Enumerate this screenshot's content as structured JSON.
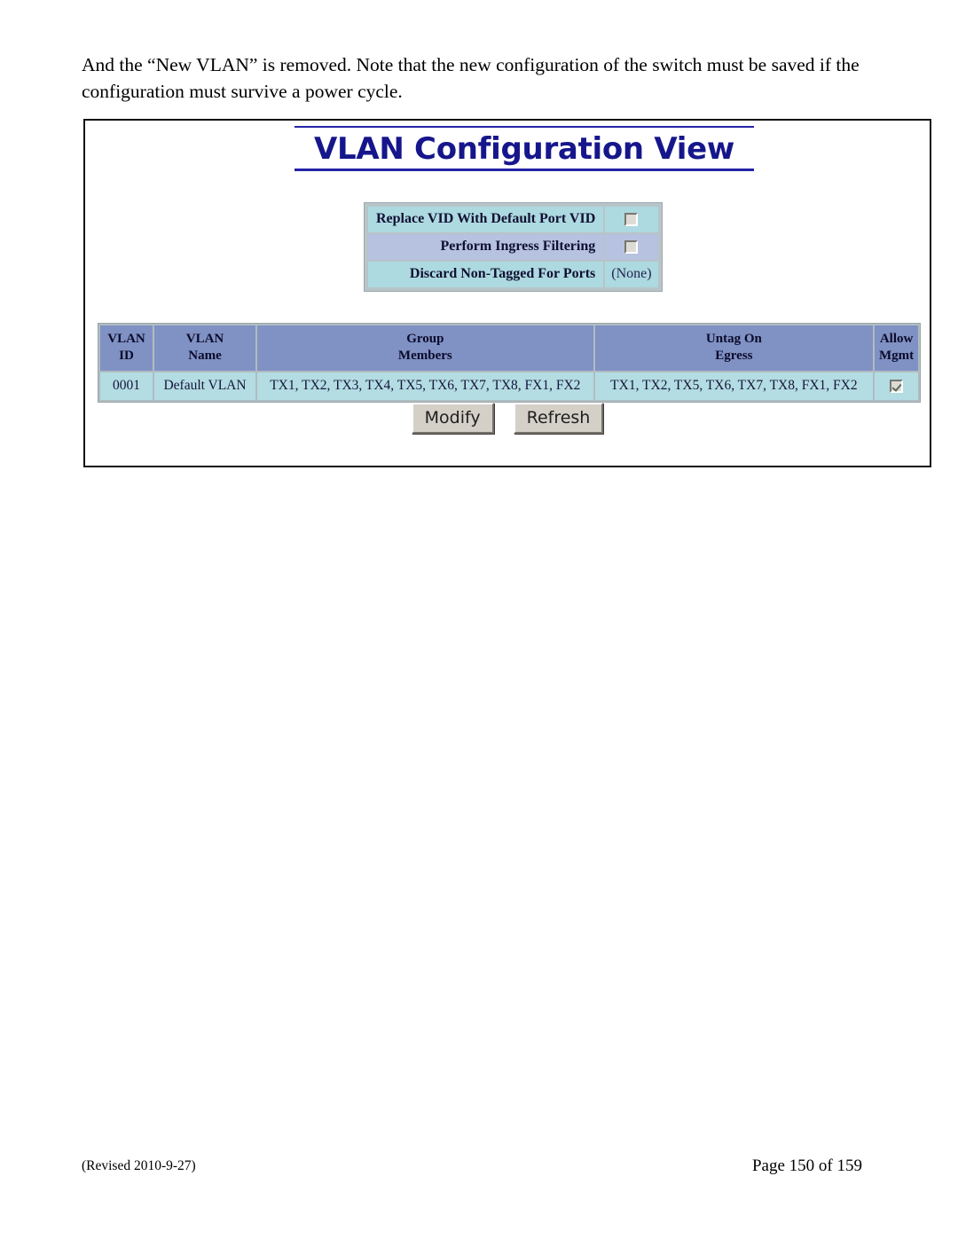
{
  "document": {
    "body_text": "And the “New VLAN” is removed. Note that the new configuration of the switch must be saved if the configuration must survive a power cycle.",
    "footer": {
      "revision": "(Revised 2010-9-27)",
      "page_number": "Page 150 of 159"
    }
  },
  "screenshot": {
    "title": "VLAN Configuration View",
    "options": [
      {
        "label": "Replace VID With Default Port VID",
        "control": "checkbox",
        "checked": false,
        "value_text": ""
      },
      {
        "label": "Perform Ingress Filtering",
        "control": "checkbox",
        "checked": false,
        "value_text": ""
      },
      {
        "label": "Discard Non-Tagged For Ports",
        "control": "text",
        "checked": false,
        "value_text": "(None)"
      }
    ],
    "table": {
      "headers": [
        {
          "line1": "VLAN",
          "line2": "ID"
        },
        {
          "line1": "VLAN",
          "line2": "Name"
        },
        {
          "line1": "Group",
          "line2": "Members"
        },
        {
          "line1": "Untag On",
          "line2": "Egress"
        },
        {
          "line1": "Allow",
          "line2": "Mgmt"
        }
      ],
      "rows": [
        {
          "vlan_id": "0001",
          "vlan_name": "Default VLAN",
          "group_members": "TX1, TX2, TX3, TX4, TX5, TX6, TX7, TX8, FX1, FX2",
          "untag_on_egress": "TX1, TX2, TX5, TX6, TX7, TX8, FX1, FX2",
          "allow_mgmt": true
        }
      ]
    },
    "buttons": {
      "modify": "Modify",
      "refresh": "Refresh"
    }
  },
  "colors": {
    "title_blue": "#16168c",
    "rule_blue": "#2424a8",
    "header_row": "#8091c4",
    "data_row": "#b3dce3",
    "option_row_cyan": "#add9e0",
    "option_row_blue": "#b6c2e0",
    "button_face": "#d4d0c8"
  }
}
